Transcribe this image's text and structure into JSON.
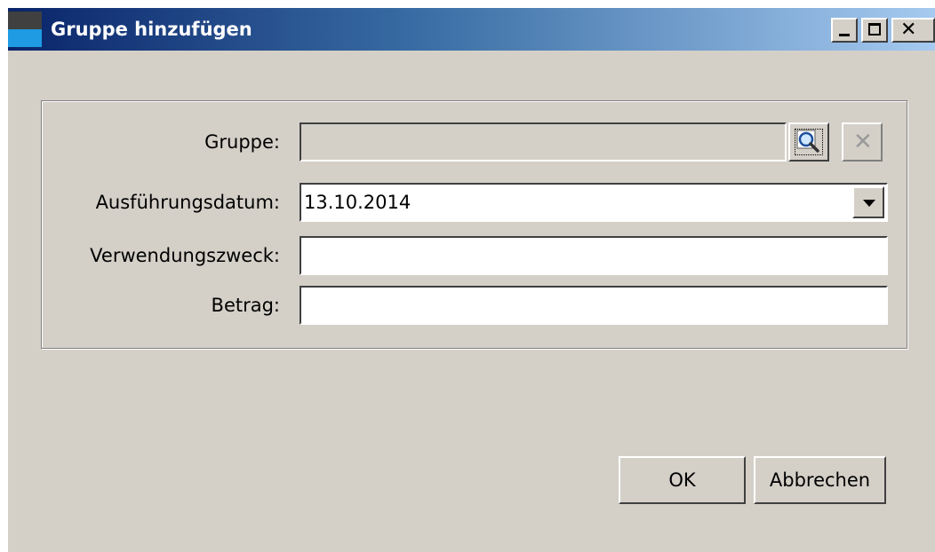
{
  "window": {
    "title": "Gruppe hinzufügen",
    "controls": {
      "minimize": "minimize-icon",
      "maximize": "maximize-icon",
      "close": "close-icon"
    },
    "titlebar_colors": [
      "#0a246a",
      "#3a6ea5",
      "#a6caf0"
    ],
    "background": "#d4d0c8"
  },
  "form": {
    "gruppe": {
      "label": "Gruppe:",
      "value": "",
      "search_icon": "magnifier-icon",
      "clear_icon": "clear-x-icon"
    },
    "ausfuehrungsdatum": {
      "label": "Ausführungsdatum:",
      "value": "13.10.2014",
      "dropdown_icon": "chevron-down-icon"
    },
    "verwendungszweck": {
      "label": "Verwendungszweck:",
      "value": ""
    },
    "betrag": {
      "label": "Betrag:",
      "value": ""
    }
  },
  "buttons": {
    "ok": "OK",
    "cancel": "Abbrechen"
  }
}
